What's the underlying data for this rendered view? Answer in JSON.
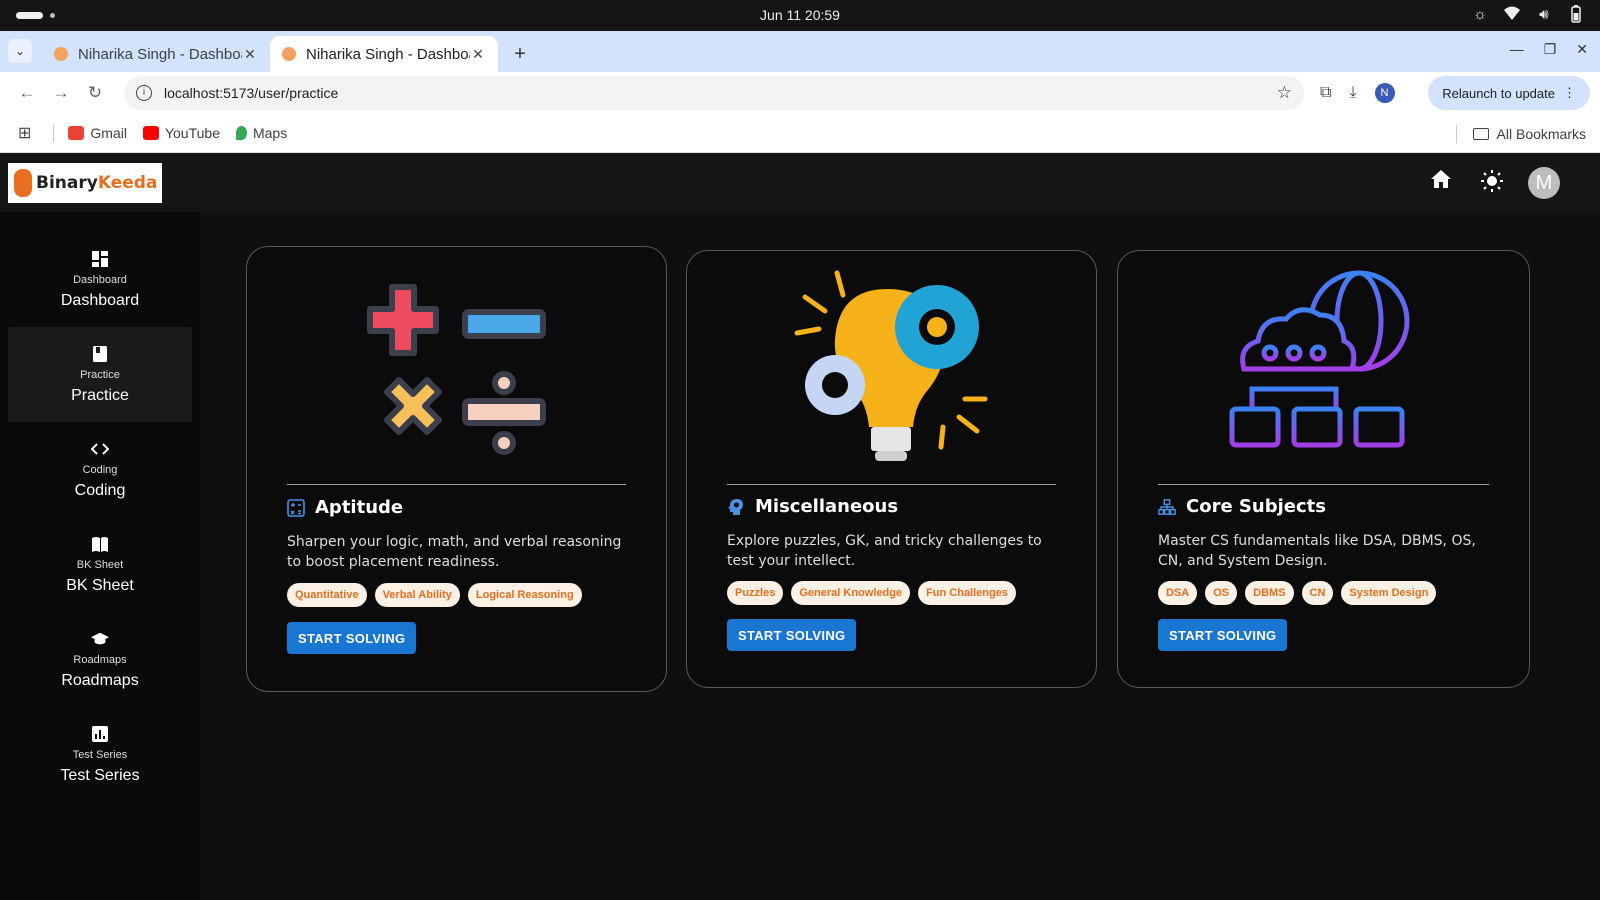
{
  "os": {
    "clock": "Jun 11  20:59"
  },
  "browser": {
    "tabs": [
      {
        "title": "Niharika Singh - Dashboard",
        "active": false
      },
      {
        "title": "Niharika Singh - Dashboard",
        "active": true
      }
    ],
    "url": "localhost:5173/user/practice",
    "profile_initial": "N",
    "relaunch_label": "Relaunch to update",
    "bookmarks": [
      {
        "label": "Gmail",
        "color": "#ea4335"
      },
      {
        "label": "YouTube",
        "color": "#ff0000"
      },
      {
        "label": "Maps",
        "color": "#34a853"
      }
    ],
    "all_bookmarks_label": "All Bookmarks"
  },
  "app": {
    "logo": {
      "part1": "Binary",
      "part2": "Keeda"
    },
    "user_initial": "M",
    "sidebar": [
      {
        "small": "Dashboard",
        "label": "Dashboard",
        "icon": "dashboard-icon",
        "active": false
      },
      {
        "small": "Practice",
        "label": "Practice",
        "icon": "book-icon",
        "active": true
      },
      {
        "small": "Coding",
        "label": "Coding",
        "icon": "code-icon",
        "active": false
      },
      {
        "small": "BK Sheet",
        "label": "BK Sheet",
        "icon": "open-book-icon",
        "active": false
      },
      {
        "small": "Roadmaps",
        "label": "Roadmaps",
        "icon": "graduation-cap-icon",
        "active": false
      },
      {
        "small": "Test Series",
        "label": "Test Series",
        "icon": "bar-chart-icon",
        "active": false
      }
    ],
    "cards": [
      {
        "title": "Aptitude",
        "description": "Sharpen your logic, math, and verbal reasoning to boost placement readiness.",
        "tags": [
          "Quantitative",
          "Verbal Ability",
          "Logical Reasoning"
        ],
        "button": "START SOLVING"
      },
      {
        "title": "Miscellaneous",
        "description": "Explore puzzles, GK, and tricky challenges to test your intellect.",
        "tags": [
          "Puzzles",
          "General Knowledge",
          "Fun Challenges"
        ],
        "button": "START SOLVING"
      },
      {
        "title": "Core Subjects",
        "description": "Master CS fundamentals like DSA, DBMS, OS, CN, and System Design.",
        "tags": [
          "DSA",
          "OS",
          "DBMS",
          "CN",
          "System Design"
        ],
        "button": "START SOLVING"
      }
    ]
  }
}
